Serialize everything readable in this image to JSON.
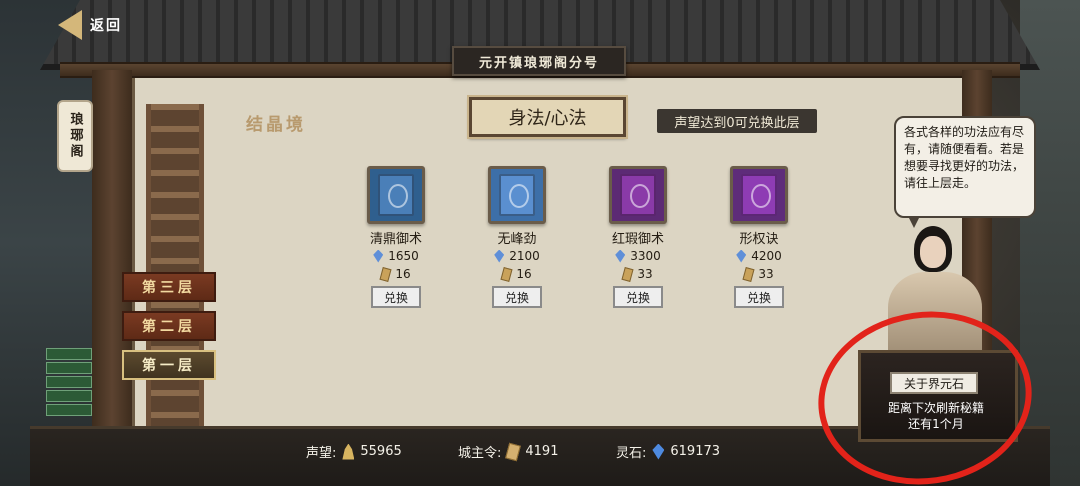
{
  "header": {
    "back_label": "返回",
    "plaque": "元开镇琅琊阁分号"
  },
  "side_sign": "琅琊阁",
  "realm_title": "结晶境",
  "category_tab": "身法/心法",
  "reputation_requirement": "声望达到0可兑换此层",
  "books": [
    {
      "name": "清鼎御术",
      "gem_cost": "1650",
      "token_cost": "16",
      "exchange_label": "兑换",
      "color": "#4a7fb8"
    },
    {
      "name": "无峰劲",
      "gem_cost": "2100",
      "token_cost": "16",
      "exchange_label": "兑换",
      "color": "#5a8fd0"
    },
    {
      "name": "红瑕御术",
      "gem_cost": "3300",
      "token_cost": "33",
      "exchange_label": "兑换",
      "color": "#8a3aa8"
    },
    {
      "name": "形权诀",
      "gem_cost": "4200",
      "token_cost": "33",
      "exchange_label": "兑换",
      "color": "#8e3cb4"
    }
  ],
  "floors": [
    {
      "label": "第三层",
      "active": false
    },
    {
      "label": "第二层",
      "active": false
    },
    {
      "label": "第一层",
      "active": true
    }
  ],
  "npc_speech": "各式各样的功法应有尽有，请随便看看。若是想要寻找更好的功法，请往上层走。",
  "about_stone_label": "关于界元石",
  "refresh_text_line1": "距离下次刷新秘籍",
  "refresh_text_line2": "还有1个月",
  "currencies": {
    "fame_label": "声望:",
    "fame_value": "55965",
    "token_label": "城主令:",
    "token_value": "4191",
    "stone_label": "灵石:",
    "stone_value": "619173"
  },
  "colors": {
    "annotation_circle": "#e2231a",
    "floor_active": "#d8c080"
  }
}
